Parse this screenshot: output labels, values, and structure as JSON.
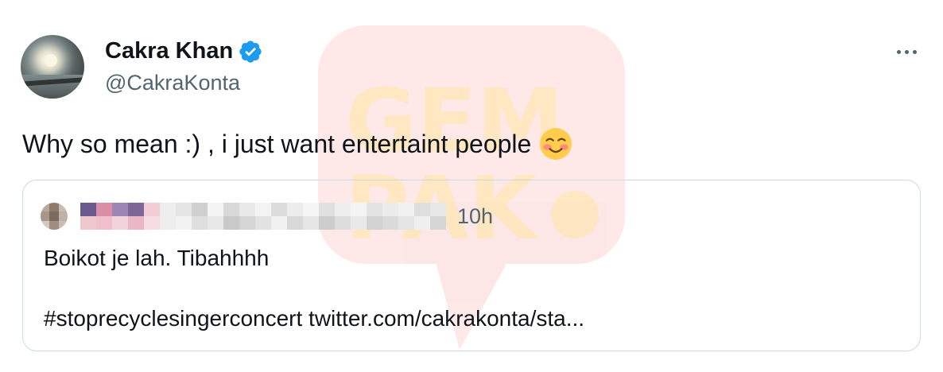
{
  "tweet": {
    "author": {
      "display_name": "Cakra Khan",
      "handle": "@CakraKonta",
      "verified": true,
      "avatar_icon": "avatar-sunset-sea"
    },
    "text": "Why so mean :) , i just want entertaint people",
    "emoji": "smiling-face-with-blush-icon",
    "more_icon": "more-horizontal-icon"
  },
  "quoted_tweet": {
    "author_blurred": true,
    "time": "10h",
    "line1": "Boikot je lah. Tibahhhh",
    "line2": "#stoprecyclesingerconcert twitter.com/cakrakonta/sta..."
  },
  "watermark": {
    "line1": "GEM",
    "line2": "PAK",
    "color": "#f52a2a"
  },
  "colors": {
    "text_primary": "#0f1419",
    "text_secondary": "#536471",
    "verified_blue": "#1d9bf0",
    "border": "#cfd9de"
  }
}
